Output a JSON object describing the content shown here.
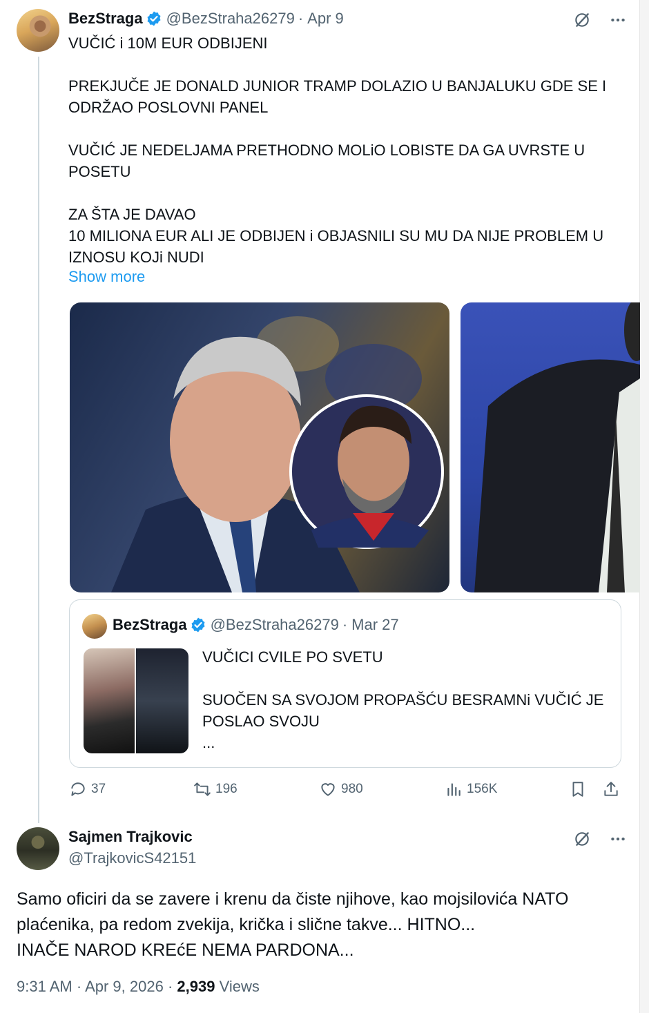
{
  "tweet": {
    "author_name": "BezStraga",
    "handle": "@BezStraha26279",
    "separator": "·",
    "date": "Apr 9",
    "lines": [
      "VUČIĆ i 10M EUR ODBIJENI",
      "",
      "PREKJUČE JE DONALD JUNIOR TRAMP DOLAZIO U BANJALUKU GDE SE I",
      "ODRŽAO POSLOVNI PANEL",
      "",
      "VUČIĆ JE NEDELJAMA PRETHODNO MOLiO LOBISTE DA GA UVRSTE U",
      "POSETU",
      "",
      "ZA ŠTA JE DAVAO",
      "10 MILIONA EUR ALI JE ODBIJEN i OBJASNILI SU MU DA NIJE PROBLEM U",
      "IZNOSU KOJi NUDI"
    ],
    "show_more": "Show more",
    "more_icon": "more-dots-icon",
    "grok_icon": "grok-icon",
    "verified_color": "#1d9bf0"
  },
  "quote": {
    "author_name": "BezStraga",
    "handle": "@BezStraha26279",
    "separator": "·",
    "date": "Mar 27",
    "lines": [
      "VUČICI CVILE PO SVETU",
      "",
      "SUOČEN SA SVOJOM PROPAŠĆU BESRAMNi VUČIĆ JE",
      "POSLAO SVOJU",
      "..."
    ]
  },
  "actions": {
    "replies": "37",
    "reposts": "196",
    "likes": "980",
    "views": "156K"
  },
  "reply": {
    "author_name": "Sajmen Trajkovic",
    "handle": "@TrajkovicS42151",
    "lines": [
      "Samo oficiri da se zavere i krenu da čiste njihove, kao mojsilovića NATO",
      "plaćenika, pa redom zvekija, krička i slične takve... HITNO...",
      "INAČE NAROD KREćE NEMA PARDONA..."
    ],
    "time": "9:31 AM",
    "separator": "·",
    "full_date": "Apr 9, 2026",
    "views_count": "2,939",
    "views_label": "Views"
  }
}
